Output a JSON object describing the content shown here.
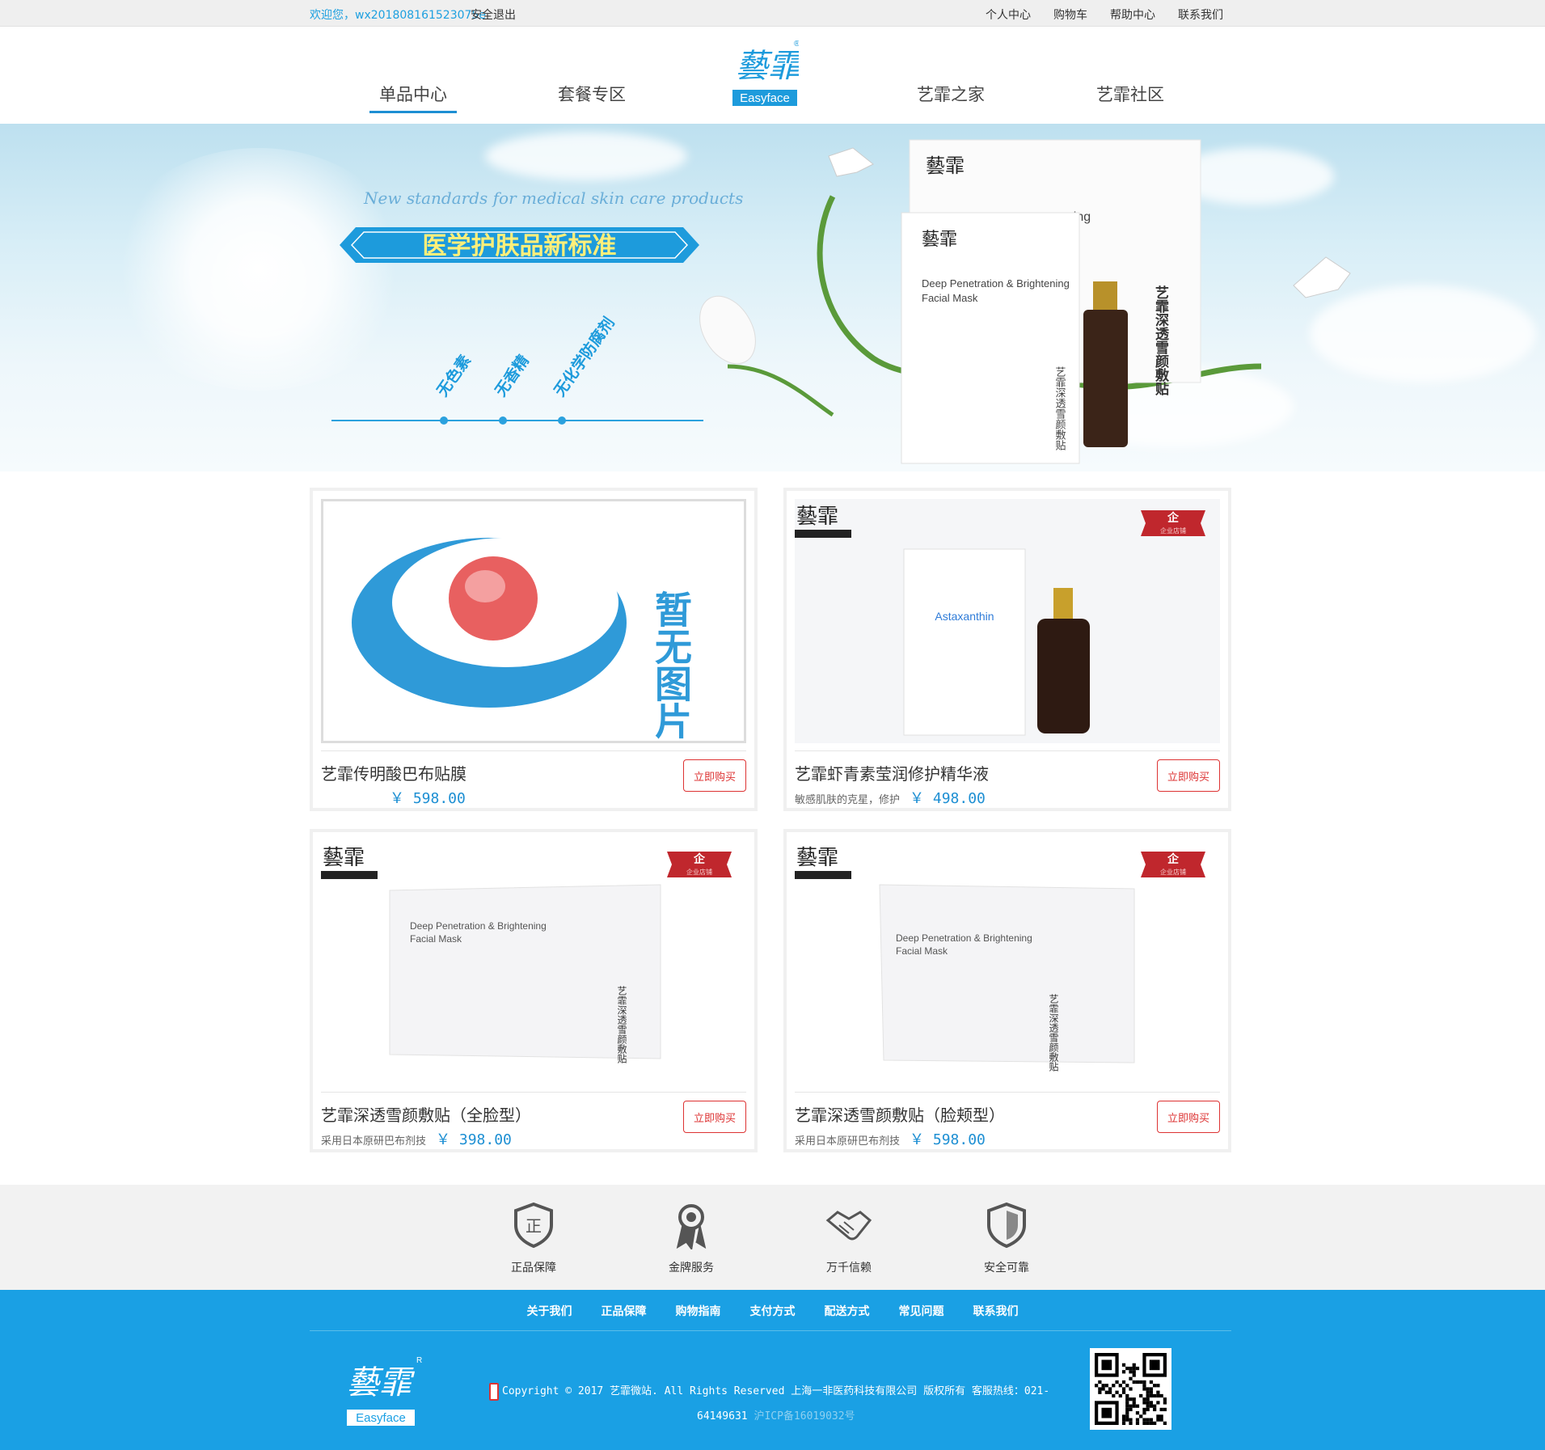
{
  "topbar": {
    "welcome_prefix": "欢迎您，",
    "username": "wx201808161523075e",
    "logout": "安全退出",
    "links": [
      "个人中心",
      "购物车",
      "帮助中心",
      "联系我们"
    ]
  },
  "nav": {
    "items": [
      {
        "label": "单品中心",
        "active": true
      },
      {
        "label": "套餐专区",
        "active": false
      },
      {
        "label": "艺霏之家",
        "active": false
      },
      {
        "label": "艺霏社区",
        "active": false
      }
    ],
    "logo_text": "Easyface"
  },
  "banner": {
    "tagline_en": "New standards for medical skin care products",
    "tagline_cn": "医学护肤品新标准",
    "features": [
      "无色素",
      "无香精",
      "无化学防腐剂"
    ],
    "box_text": "Deep Penetration & Brightening Facial Mask",
    "box_cn": "艺霏深透雪颜敷贴"
  },
  "products": [
    {
      "name": "艺霏传明酸巴布贴膜",
      "desc": "",
      "price": "￥ 598.00",
      "buy": "立即购买",
      "image": "no-image",
      "no_image_text": "暂无图片"
    },
    {
      "name": "艺霏虾青素莹润修护精华液",
      "desc": "敏感肌肤的克星，修护",
      "price": "￥ 498.00",
      "buy": "立即购买",
      "image": "essence",
      "box_label": "Astaxanthin"
    },
    {
      "name": "艺霏深透雪颜敷贴（全脸型）",
      "desc": "采用日本原研巴布剂技",
      "price": "￥ 398.00",
      "buy": "立即购买",
      "image": "mask"
    },
    {
      "name": "艺霏深透雪颜敷贴（脸颊型）",
      "desc": "采用日本原研巴布剂技",
      "price": "￥ 598.00",
      "buy": "立即购买",
      "image": "mask"
    }
  ],
  "badge_text": "企业店铺",
  "services": [
    {
      "label": "正品保障",
      "icon": "shield-zheng-icon"
    },
    {
      "label": "金牌服务",
      "icon": "medal-icon"
    },
    {
      "label": "万千信赖",
      "icon": "handshake-icon"
    },
    {
      "label": "安全可靠",
      "icon": "shield-icon"
    }
  ],
  "footer": {
    "links": [
      "关于我们",
      "正品保障",
      "购物指南",
      "支付方式",
      "配送方式",
      "常见问题",
      "联系我们"
    ],
    "copyright": "Copyright © 2017 艺霏微站. All Rights Reserved 上海一非医药科技有限公司 版权所有 客服热线：021-",
    "phone_tail": "64149631",
    "icp": "沪ICP备16019032号",
    "logo_text": "Easyface"
  },
  "colors": {
    "brand_blue": "#1aa0e4",
    "buy_red": "#dd3333"
  }
}
